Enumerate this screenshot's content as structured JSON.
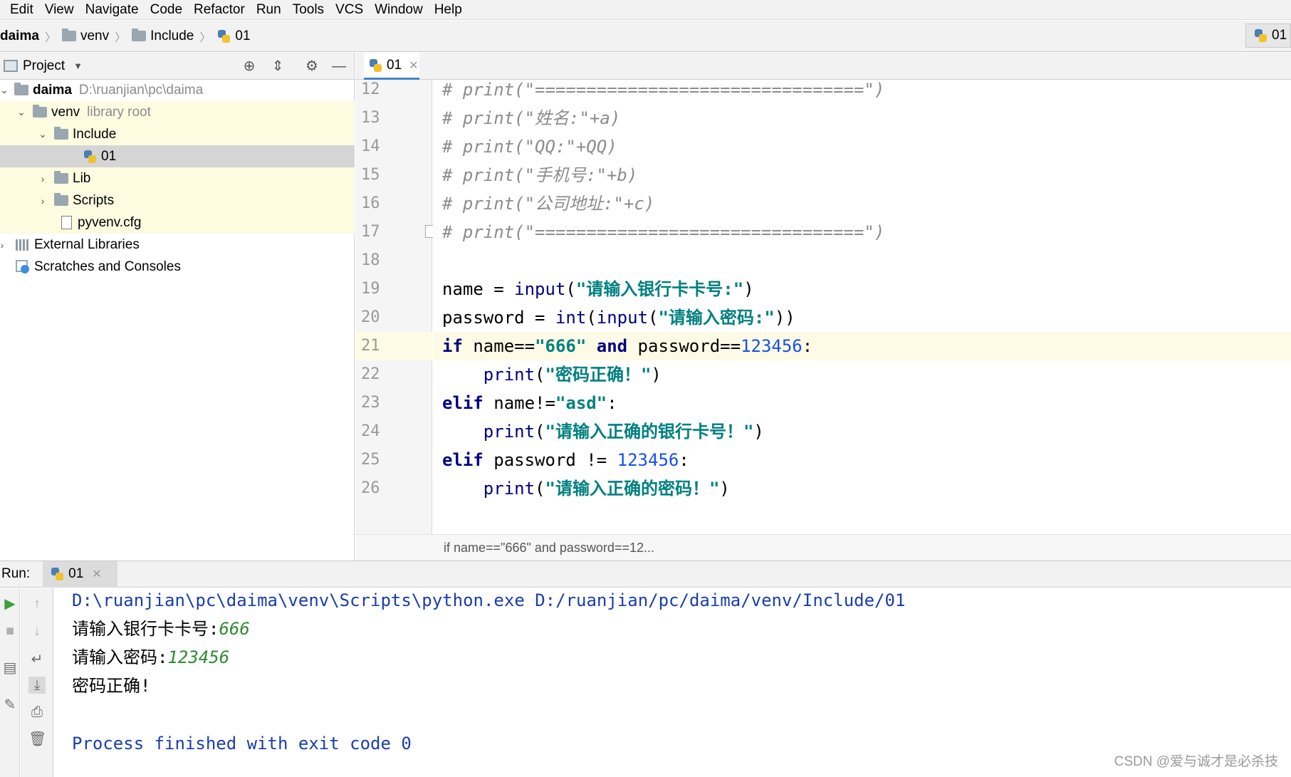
{
  "menu": [
    "Edit",
    "View",
    "Navigate",
    "Code",
    "Refactor",
    "Run",
    "Tools",
    "VCS",
    "Window",
    "Help"
  ],
  "navbar": {
    "crumbs": [
      "daima",
      "venv",
      "Include",
      "01"
    ],
    "run_config": "01"
  },
  "project": {
    "title": "Project",
    "tree": [
      {
        "label": "daima",
        "extra": "D:\\ruanjian\\pc\\daima"
      },
      {
        "label": "venv",
        "extra": "library root"
      },
      {
        "label": "Include",
        "extra": ""
      },
      {
        "label": "01",
        "extra": ""
      },
      {
        "label": "Lib",
        "extra": ""
      },
      {
        "label": "Scripts",
        "extra": ""
      },
      {
        "label": "pyvenv.cfg",
        "extra": ""
      },
      {
        "label": "External Libraries",
        "extra": ""
      },
      {
        "label": "Scratches and Consoles",
        "extra": ""
      }
    ]
  },
  "editor": {
    "tab": "01",
    "line_numbers": [
      "12",
      "13",
      "14",
      "15",
      "16",
      "17",
      "18",
      "19",
      "20",
      "21",
      "22",
      "23",
      "24",
      "25",
      "26"
    ],
    "code": {
      "l12": "# print(\"================================\")",
      "l13": "# print(\"姓名:\"+a)",
      "l14": "# print(\"QQ:\"+QQ)",
      "l15": "# print(\"手机号:\"+b)",
      "l16": "# print(\"公司地址:\"+c)",
      "l17": "# print(\"================================\")",
      "l19_a": "name = ",
      "l19_b": "input",
      "l19_c": "(",
      "l19_d": "\"请输入银行卡卡号:\"",
      "l19_e": ")",
      "l20_a": "password = ",
      "l20_b": "int",
      "l20_c": "(",
      "l20_d": "input",
      "l20_e": "(",
      "l20_f": "\"请输入密码:\"",
      "l20_g": "))",
      "l21_a": "if",
      "l21_b": " name==",
      "l21_c": "\"666\"",
      "l21_d": " and",
      "l21_e": " password==",
      "l21_f": "123456",
      "l21_g": ":",
      "l22_a": "    ",
      "l22_b": "print",
      "l22_c": "(",
      "l22_d": "\"密码正确！\"",
      "l22_e": ")",
      "l23_a": "elif",
      "l23_b": " name!=",
      "l23_c": "\"asd\"",
      "l23_d": ":",
      "l24_a": "    ",
      "l24_b": "print",
      "l24_c": "(",
      "l24_d": "\"请输入正确的银行卡号！\"",
      "l24_e": ")",
      "l25_a": "elif",
      "l25_b": " password != ",
      "l25_c": "123456",
      "l25_d": ":",
      "l26_a": "    ",
      "l26_b": "print",
      "l26_c": "(",
      "l26_d": "\"请输入正确的密码！\"",
      "l26_e": ")"
    },
    "breadcrumb": "if name==\"666\" and password==12..."
  },
  "run": {
    "label": "Run:",
    "tab": "01",
    "lines": {
      "cmd": "D:\\ruanjian\\pc\\daima\\venv\\Scripts\\python.exe D:/ruanjian/pc/daima/venv/Include/01",
      "p1": "请输入银行卡卡号:",
      "i1": "666",
      "p2": "请输入密码:",
      "i2": "123456",
      "out": "密码正确!",
      "exit": "Process finished with exit code 0"
    }
  },
  "watermark": "CSDN @爱与诚才是必杀技"
}
